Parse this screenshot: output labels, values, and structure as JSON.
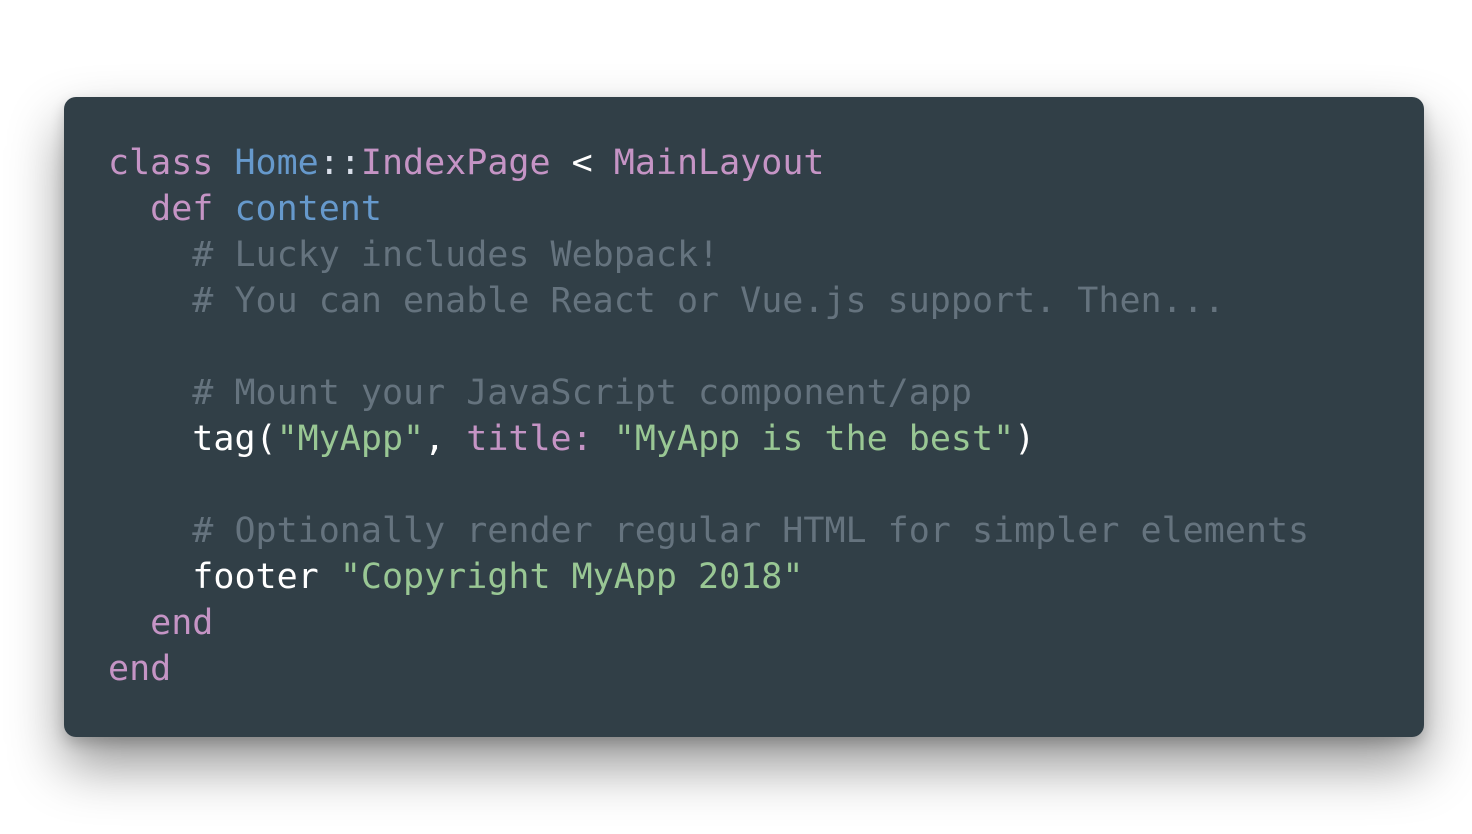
{
  "colors": {
    "background": "#313f47",
    "keyword": "#c594c5",
    "class_name": "#6699cc",
    "method_name": "#6699cc",
    "comment": "#65737e",
    "string": "#99c794",
    "plain": "#ffffff",
    "punctuation": "#d8dee9"
  },
  "code_lines": [
    {
      "indent": 0,
      "tokens": [
        {
          "text": "class",
          "type": "keyword"
        },
        {
          "text": " ",
          "type": "plain"
        },
        {
          "text": "Home",
          "type": "class_name"
        },
        {
          "text": "::",
          "type": "punctuation"
        },
        {
          "text": "IndexPage",
          "type": "keyword"
        },
        {
          "text": " < ",
          "type": "plain"
        },
        {
          "text": "MainLayout",
          "type": "keyword"
        }
      ]
    },
    {
      "indent": 2,
      "tokens": [
        {
          "text": "def",
          "type": "keyword"
        },
        {
          "text": " ",
          "type": "plain"
        },
        {
          "text": "content",
          "type": "method_name"
        }
      ]
    },
    {
      "indent": 4,
      "tokens": [
        {
          "text": "# Lucky includes Webpack!",
          "type": "comment"
        }
      ]
    },
    {
      "indent": 4,
      "tokens": [
        {
          "text": "# You can enable React or Vue.js support. Then...",
          "type": "comment"
        }
      ]
    },
    {
      "indent": 0,
      "tokens": []
    },
    {
      "indent": 4,
      "tokens": [
        {
          "text": "# Mount your JavaScript component/app",
          "type": "comment"
        }
      ]
    },
    {
      "indent": 4,
      "tokens": [
        {
          "text": "tag(",
          "type": "plain"
        },
        {
          "text": "\"MyApp\"",
          "type": "string"
        },
        {
          "text": ", ",
          "type": "plain"
        },
        {
          "text": "title:",
          "type": "keyword"
        },
        {
          "text": " ",
          "type": "plain"
        },
        {
          "text": "\"MyApp is the best\"",
          "type": "string"
        },
        {
          "text": ")",
          "type": "plain"
        }
      ]
    },
    {
      "indent": 0,
      "tokens": []
    },
    {
      "indent": 4,
      "tokens": [
        {
          "text": "# Optionally render regular HTML for simpler elements",
          "type": "comment"
        }
      ]
    },
    {
      "indent": 4,
      "tokens": [
        {
          "text": "footer",
          "type": "plain"
        },
        {
          "text": " ",
          "type": "plain"
        },
        {
          "text": "\"Copyright MyApp 2018\"",
          "type": "string"
        }
      ]
    },
    {
      "indent": 2,
      "tokens": [
        {
          "text": "end",
          "type": "keyword"
        }
      ]
    },
    {
      "indent": 0,
      "tokens": [
        {
          "text": "end",
          "type": "keyword"
        }
      ]
    }
  ]
}
